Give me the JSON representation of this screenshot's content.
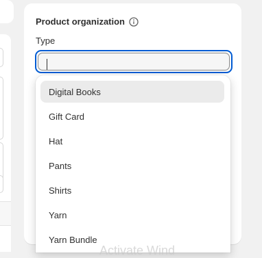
{
  "product_organization": {
    "title": "Product organization",
    "type_label": "Type",
    "type_value": ""
  },
  "dropdown": {
    "options": [
      {
        "label": "Digital Books",
        "highlighted": true
      },
      {
        "label": "Gift Card"
      },
      {
        "label": "Hat"
      },
      {
        "label": "Pants"
      },
      {
        "label": "Shirts"
      },
      {
        "label": "Yarn"
      },
      {
        "label": "Yarn Bundle"
      }
    ]
  },
  "watermark": "Activate Wind",
  "colors": {
    "focus_ring": "#005bd3",
    "highlight": "#ebebeb",
    "background": "#f1f1f1"
  }
}
